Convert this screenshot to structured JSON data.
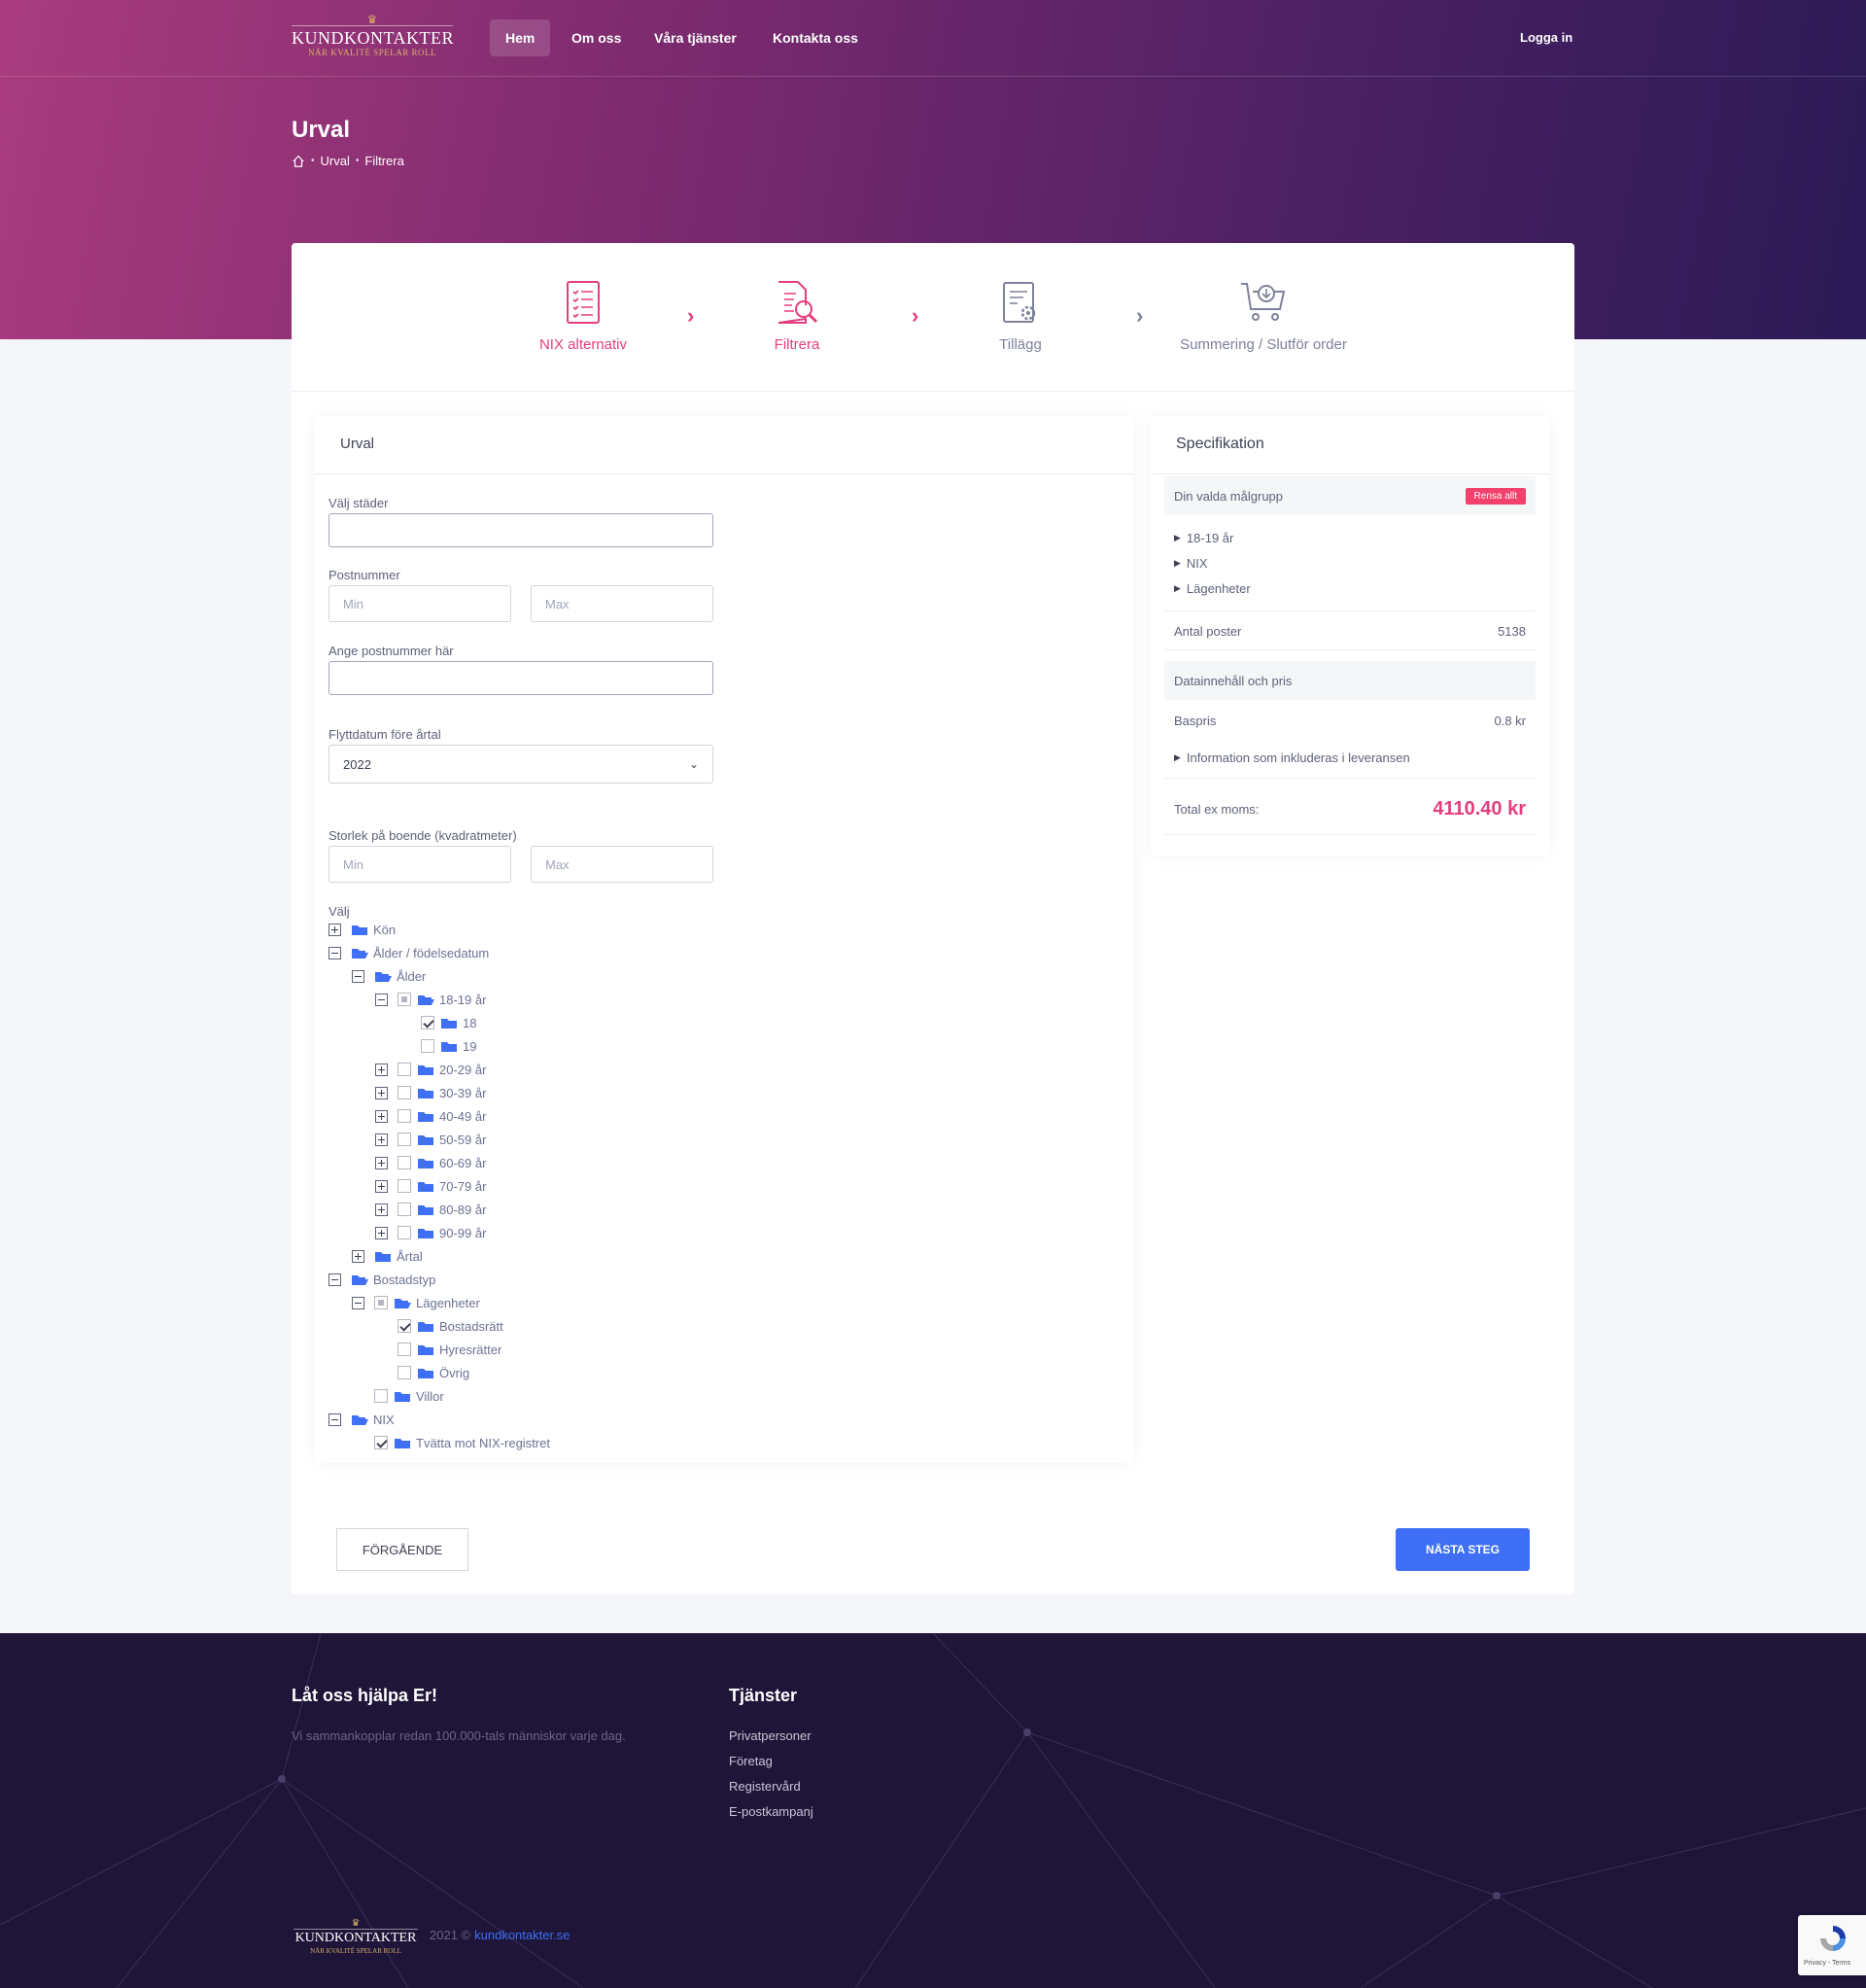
{
  "nav": {
    "logo": {
      "brand": "KUNDKONTAKTER",
      "tagline": "NÄR KVALITÉ SPELAR ROLL"
    },
    "links": [
      "Hem",
      "Om oss",
      "Våra tjänster",
      "Kontakta oss"
    ],
    "login": "Logga in"
  },
  "header": {
    "title": "Urval",
    "breadcrumb": [
      "Urval",
      "Filtrera"
    ]
  },
  "steps": [
    {
      "label": "NIX alternativ",
      "state": "done"
    },
    {
      "label": "Filtrera",
      "state": "active"
    },
    {
      "label": "Tillägg",
      "state": "todo"
    },
    {
      "label": "Summering / Slutför order",
      "state": "todo"
    }
  ],
  "form": {
    "title": "Urval",
    "cities_label": "Välj städer",
    "postal_label": "Postnummer",
    "postal_min": "Min",
    "postal_max": "Max",
    "postal_enter_label": "Ange postnummer här",
    "move_label": "Flyttdatum före årtal",
    "move_value": "2022",
    "size_label": "Storlek på boende (kvadratmeter)",
    "size_min": "Min",
    "size_max": "Max",
    "choose_label": "Välj"
  },
  "tree": [
    {
      "label": "Kön",
      "toggle": "plus",
      "cb": "",
      "open": false
    },
    {
      "label": "Ålder / födelsedatum",
      "toggle": "minus",
      "cb": "",
      "open": true
    },
    {
      "label": "Ålder",
      "toggle": "minus",
      "cb": "",
      "open": true
    },
    {
      "label": "18-19 år",
      "toggle": "minus",
      "cb": "partial",
      "open": true
    },
    {
      "label": "18",
      "toggle": "",
      "cb": "checked",
      "open": false
    },
    {
      "label": "19",
      "toggle": "",
      "cb": "empty",
      "open": false
    },
    {
      "label": "20-29 år",
      "toggle": "plus",
      "cb": "empty",
      "open": false
    },
    {
      "label": "30-39 år",
      "toggle": "plus",
      "cb": "empty",
      "open": false
    },
    {
      "label": "40-49 år",
      "toggle": "plus",
      "cb": "empty",
      "open": false
    },
    {
      "label": "50-59 år",
      "toggle": "plus",
      "cb": "empty",
      "open": false
    },
    {
      "label": "60-69 år",
      "toggle": "plus",
      "cb": "empty",
      "open": false
    },
    {
      "label": "70-79 år",
      "toggle": "plus",
      "cb": "empty",
      "open": false
    },
    {
      "label": "80-89 år",
      "toggle": "plus",
      "cb": "empty",
      "open": false
    },
    {
      "label": "90-99 år",
      "toggle": "plus",
      "cb": "empty",
      "open": false
    },
    {
      "label": "Årtal",
      "toggle": "plus",
      "cb": "",
      "open": false
    },
    {
      "label": "Bostadstyp",
      "toggle": "minus",
      "cb": "",
      "open": true
    },
    {
      "label": "Lägenheter",
      "toggle": "minus",
      "cb": "partial",
      "open": true
    },
    {
      "label": "Bostadsrätt",
      "toggle": "",
      "cb": "checked",
      "open": false
    },
    {
      "label": "Hyresrätter",
      "toggle": "",
      "cb": "empty",
      "open": false
    },
    {
      "label": "Övrig",
      "toggle": "",
      "cb": "empty",
      "open": false
    },
    {
      "label": "Villor",
      "toggle": "",
      "cb": "empty",
      "open": false
    },
    {
      "label": "NIX",
      "toggle": "minus",
      "cb": "",
      "open": true
    },
    {
      "label": "Tvätta mot NIX-registret",
      "toggle": "",
      "cb": "checked",
      "open": false
    }
  ],
  "spec": {
    "title": "Specifikation",
    "group_label": "Din valda målgrupp",
    "clear_label": "Rensa allt",
    "selected": [
      "18-19 år",
      "NIX",
      "Lägenheter"
    ],
    "count_label": "Antal poster",
    "count_value": "5138",
    "data_label": "Datainnehåll och pris",
    "base_label": "Baspris",
    "base_value": "0.8 kr",
    "info_label": "Information som inkluderas i leveransen",
    "total_label": "Total ex moms:",
    "total_value": "4110.40 kr"
  },
  "buttons": {
    "prev": "FÖRGÅENDE",
    "next": "NÄSTA STEG"
  },
  "footer": {
    "help_title": "Låt oss hjälpa Er!",
    "help_text": "Vi sammankopplar redan 100.000-tals människor varje dag.",
    "services_title": "Tjänster",
    "services": [
      "Privatpersoner",
      "Företag",
      "Registervård",
      "E-postkampanj"
    ],
    "year": "2021 ©",
    "site": "kundkontakter.se",
    "recaptcha": "Privacy - Terms"
  },
  "colors": {
    "accent": "#e33e7f",
    "primary": "#3e6ff4",
    "folder": "#3e6ff4"
  }
}
